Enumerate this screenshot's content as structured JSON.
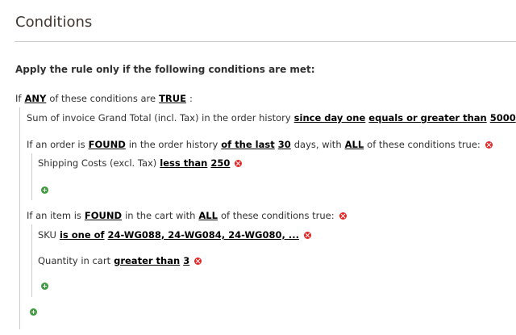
{
  "section": {
    "title": "Conditions"
  },
  "intro": "Apply the rule only if the following conditions are met:",
  "root": {
    "prefix": "If",
    "aggregator": "ANY",
    "middle": "of these conditions are",
    "value": "TRUE",
    "suffix": ":"
  },
  "cond1": {
    "text": "Sum of invoice Grand Total (incl. Tax) in the order history",
    "period": "since day one",
    "operator": "equals or greater than",
    "value": "5000"
  },
  "cond2": {
    "prefix": "If an order is",
    "found": "FOUND",
    "mid1": "in the order history",
    "period": "of the last",
    "days": "30",
    "mid2": "days, with",
    "aggregator": "ALL",
    "suffix": "of these conditions true:"
  },
  "cond2_sub": {
    "text": "Shipping Costs (excl. Tax)",
    "operator": "less than",
    "value": "250"
  },
  "cond3": {
    "prefix": "If an item is",
    "found": "FOUND",
    "mid": "in the cart with",
    "aggregator": "ALL",
    "suffix": "of these conditions true:"
  },
  "cond3_sub1": {
    "text": "SKU",
    "operator": "is one of",
    "value": "24-WG088, 24-WG084, 24-WG080, ..."
  },
  "cond3_sub2": {
    "text": "Quantity in cart",
    "operator": "greater than",
    "value": "3"
  },
  "icons": {
    "remove": "remove-circle-icon",
    "add": "add-circle-icon"
  },
  "colors": {
    "remove": "#e22626",
    "add": "#3f9b3f"
  }
}
